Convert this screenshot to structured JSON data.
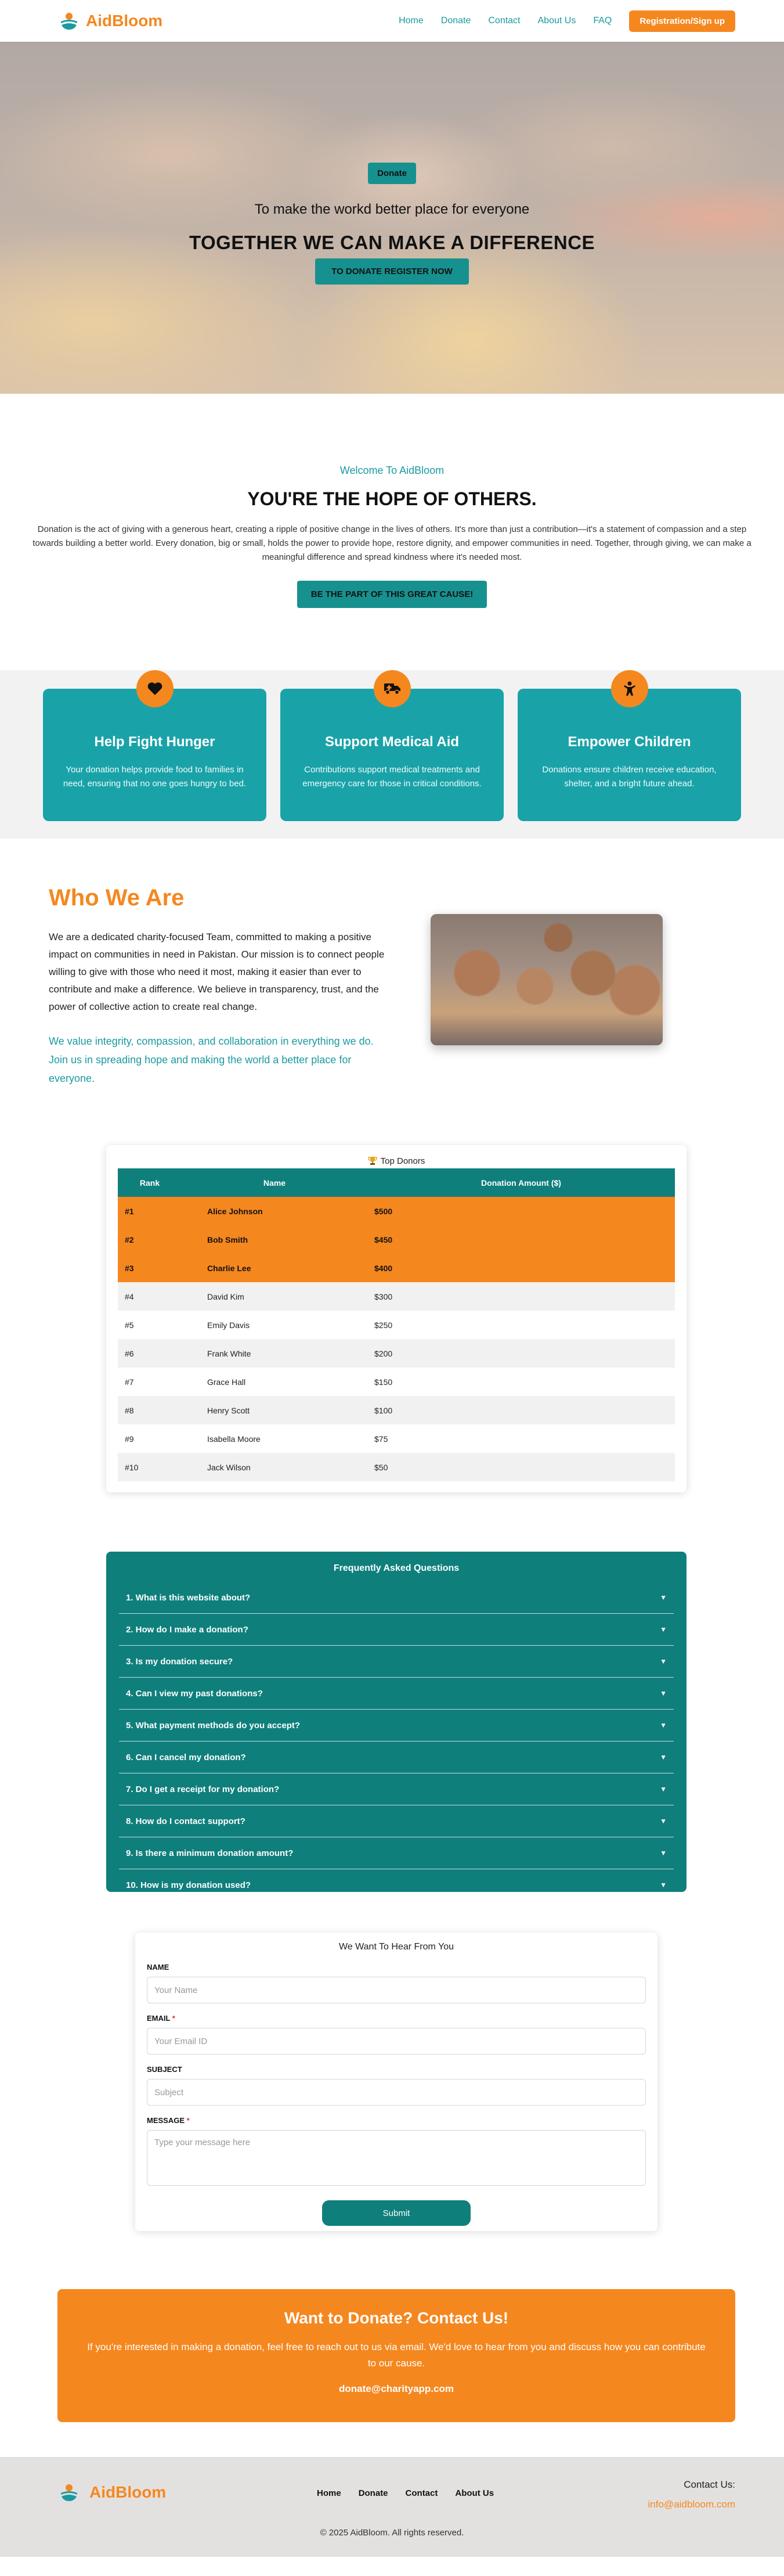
{
  "brand": {
    "name": "AidBloom"
  },
  "nav": {
    "links": [
      "Home",
      "Donate",
      "Contact",
      "About Us",
      "FAQ"
    ],
    "cta": "Registration/Sign up"
  },
  "hero": {
    "badge": "Donate",
    "subtitle": "To make the workd better place for everyone",
    "title": "TOGETHER WE CAN MAKE A DIFFERENCE",
    "button": "TO DONATE REGISTER NOW"
  },
  "welcome": {
    "kicker": "Welcome To AidBloom",
    "title": "YOU'RE THE HOPE OF OTHERS.",
    "text": "Donation is the act of giving with a generous heart, creating a ripple of positive change in the lives of others. It's more than just a contribution—it's a statement of compassion and a step towards building a better world. Every donation, big or small, holds the power to provide hope, restore dignity, and empower communities in need. Together, through giving, we can make a meaningful difference and spread kindness where it's needed most.",
    "button": "BE THE PART OF THIS GREAT CAUSE!"
  },
  "features": [
    {
      "icon": "heart-icon",
      "title": "Help Fight Hunger",
      "text": "Your donation helps provide food to families in need, ensuring that no one goes hungry to bed."
    },
    {
      "icon": "truck-icon",
      "title": "Support Medical Aid",
      "text": "Contributions support medical treatments and emergency care for those in critical conditions."
    },
    {
      "icon": "child-icon",
      "title": "Empower Children",
      "text": "Donations ensure children receive education, shelter, and a bright future ahead."
    }
  ],
  "who": {
    "title": "Who We Are",
    "text": "We are a dedicated charity-focused Team, committed to making a positive impact on communities in need in Pakistan. Our mission is to connect people willing to give with those who need it most, making it easier than ever to contribute and make a difference. We believe in transparency, trust, and the power of collective action to create real change.",
    "values": "We value integrity, compassion, and collaboration in everything we do. Join us in spreading hope and making the world a better place for everyone."
  },
  "donors": {
    "title": "Top Donors",
    "columns": [
      "Rank",
      "Name",
      "Donation Amount ($)"
    ],
    "rows": [
      [
        "#1",
        "Alice Johnson",
        "$500"
      ],
      [
        "#2",
        "Bob Smith",
        "$450"
      ],
      [
        "#3",
        "Charlie Lee",
        "$400"
      ],
      [
        "#4",
        "David Kim",
        "$300"
      ],
      [
        "#5",
        "Emily Davis",
        "$250"
      ],
      [
        "#6",
        "Frank White",
        "$200"
      ],
      [
        "#7",
        "Grace Hall",
        "$150"
      ],
      [
        "#8",
        "Henry Scott",
        "$100"
      ],
      [
        "#9",
        "Isabella Moore",
        "$75"
      ],
      [
        "#10",
        "Jack Wilson",
        "$50"
      ]
    ]
  },
  "faq": {
    "title": "Frequently Asked Questions",
    "items": [
      "1. What is this website about?",
      "2. How do I make a donation?",
      "3. Is my donation secure?",
      "4. Can I view my past donations?",
      "5. What payment methods do you accept?",
      "6. Can I cancel my donation?",
      "7. Do I get a receipt for my donation?",
      "8. How do I contact support?",
      "9. Is there a minimum donation amount?",
      "10. How is my donation used?"
    ]
  },
  "contact": {
    "title": "We Want To Hear From You",
    "name_label": "NAME",
    "name_placeholder": "Your Name",
    "email_label": "EMAIL",
    "email_placeholder": "Your Email ID",
    "subject_label": "SUBJECT",
    "subject_placeholder": "Subject",
    "message_label": "MESSAGE",
    "message_placeholder": "Type your message here",
    "required_mark": "*",
    "submit": "Submit"
  },
  "cta": {
    "title": "Want to Donate? Contact Us!",
    "text": "If you're interested in making a donation, feel free to reach out to us via email. We'd love to hear from you and discuss how you can contribute to our cause.",
    "email": "donate@charityapp.com"
  },
  "footer": {
    "links": [
      "Home",
      "Donate",
      "Contact",
      "About Us"
    ],
    "contact_label": "Contact Us:",
    "contact_email": "info@aidbloom.com",
    "copyright": "© 2025 AidBloom. All rights reserved."
  },
  "colors": {
    "orange": "#f5871f",
    "teal": "#1a9aa0",
    "dark_teal": "#0f7f7c"
  }
}
